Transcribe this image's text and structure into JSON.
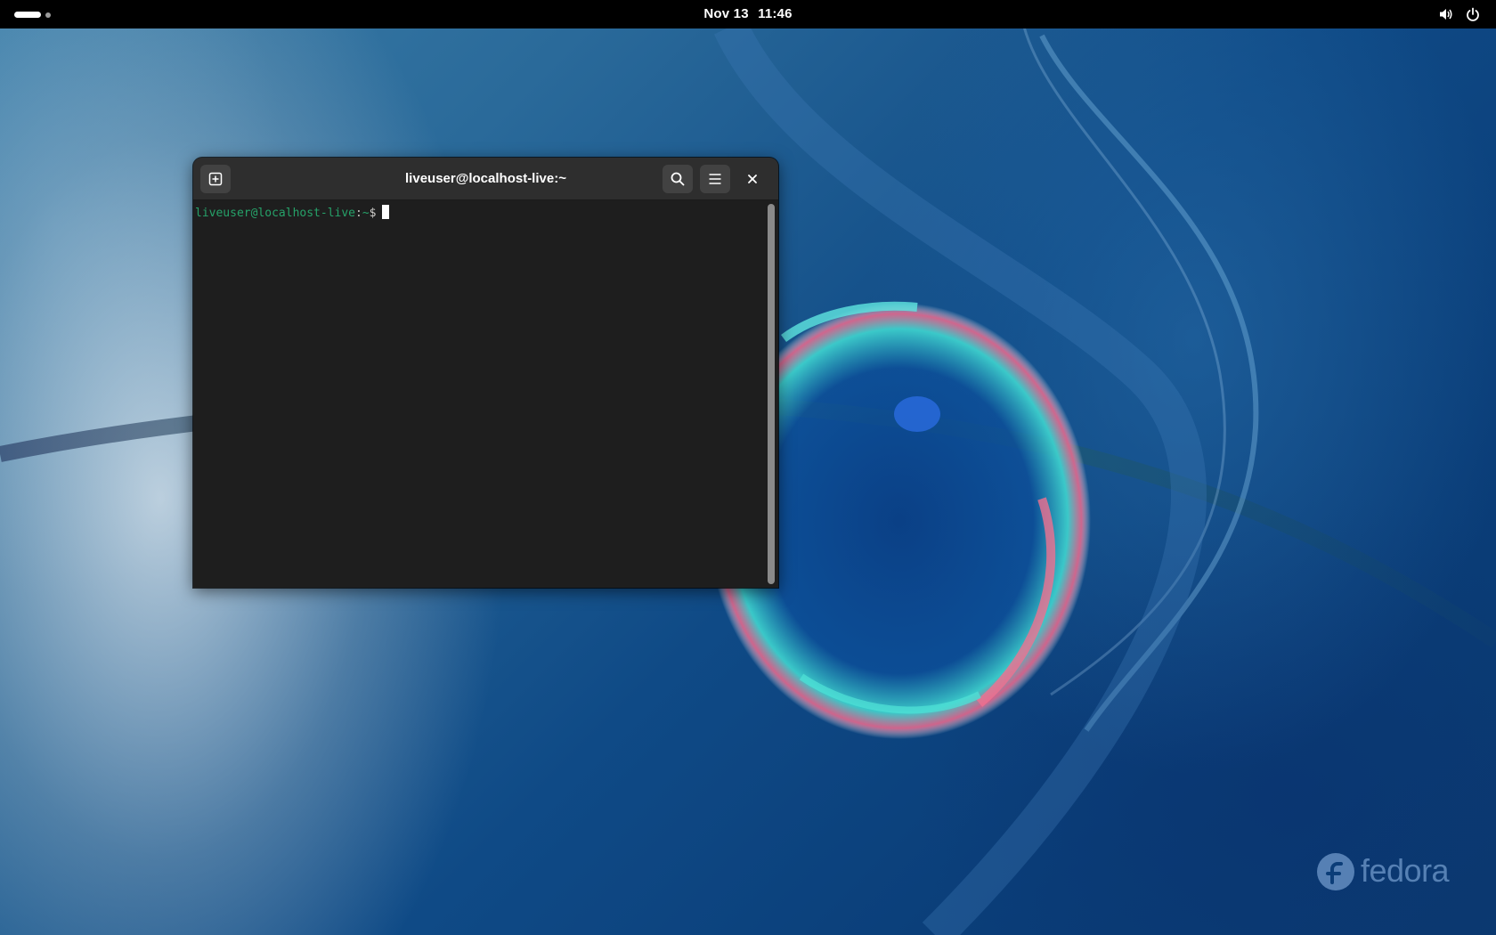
{
  "topbar": {
    "date": "Nov 13",
    "time": "11:46",
    "icons": [
      "volume-icon",
      "power-icon"
    ]
  },
  "terminal": {
    "title": "liveuser@localhost-live:~",
    "prompt": {
      "user_host": "liveuser@localhost-live",
      "separator": ":",
      "path": "~",
      "symbol": "$"
    },
    "buttons": [
      "new-tab-button",
      "search-button",
      "menu-button",
      "close-button"
    ]
  },
  "wallpaper": {
    "logo_text": "fedora"
  },
  "colors": {
    "prompt_green": "#26a269",
    "headerbar": "#2e2e2e",
    "terminal_bg": "#1e1e1e"
  }
}
